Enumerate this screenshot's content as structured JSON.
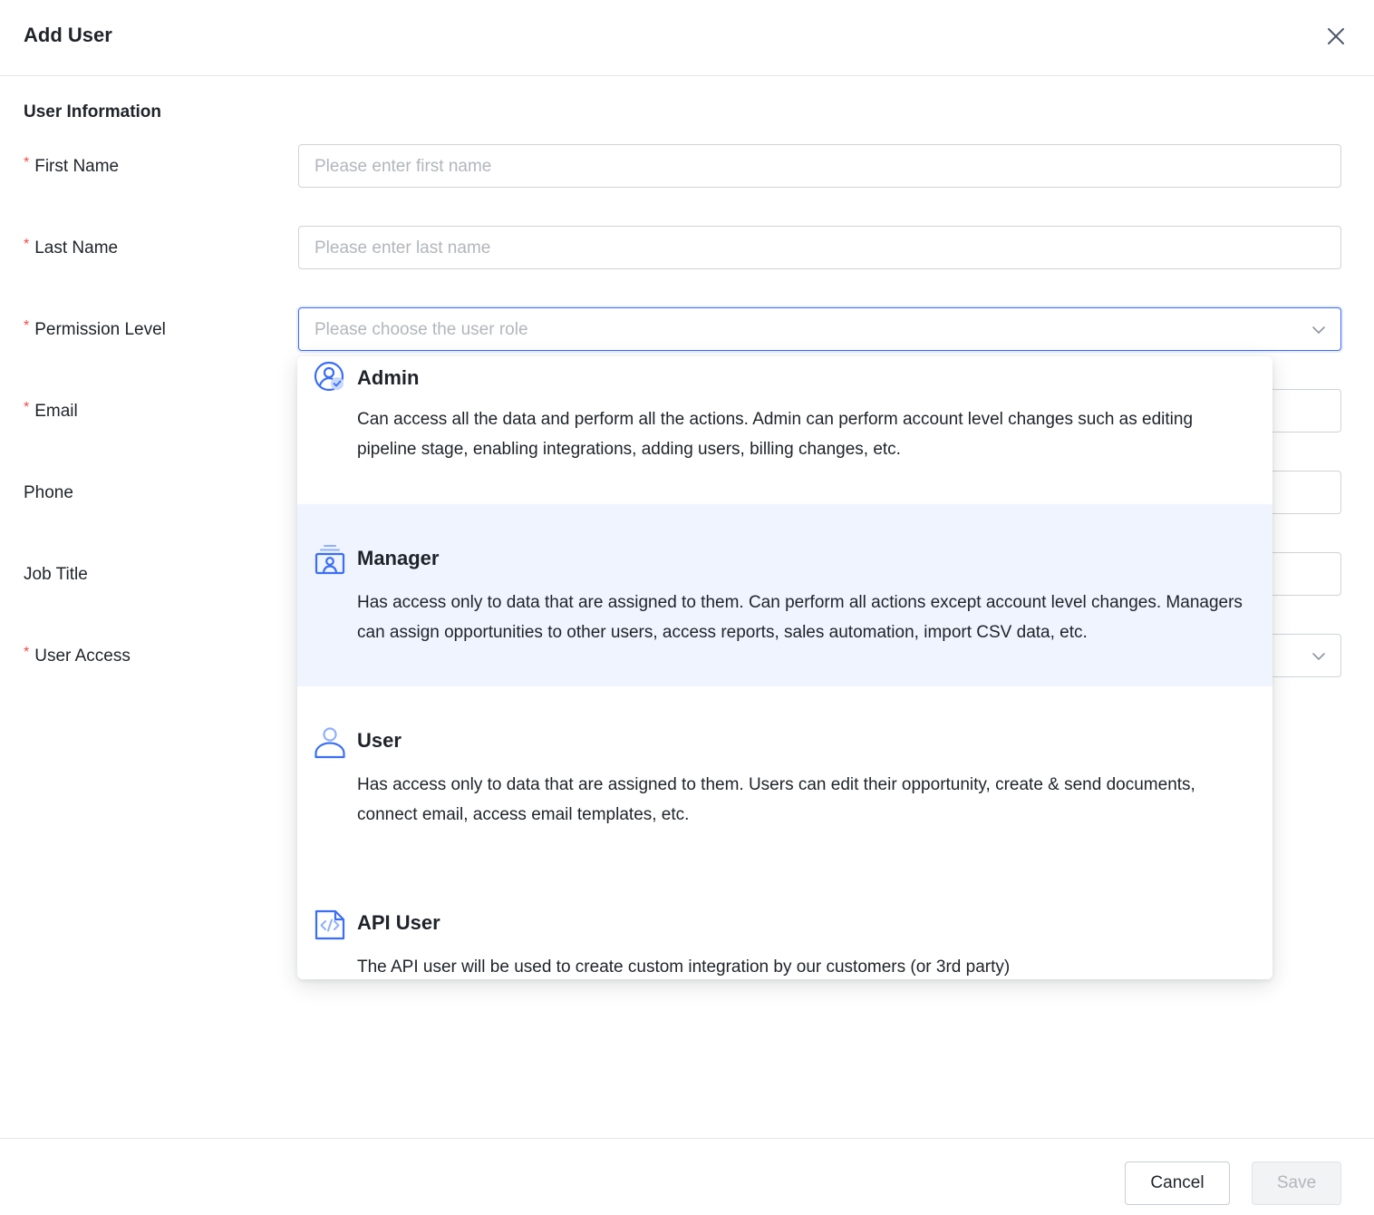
{
  "modal": {
    "title": "Add User"
  },
  "form": {
    "section_title": "User Information",
    "required_mark": "*",
    "first_name": {
      "label": "First Name",
      "placeholder": "Please enter first name"
    },
    "last_name": {
      "label": "Last Name",
      "placeholder": "Please enter last name"
    },
    "permission_level": {
      "label": "Permission Level",
      "placeholder": "Please choose the user role"
    },
    "email": {
      "label": "Email"
    },
    "phone": {
      "label": "Phone"
    },
    "job_title": {
      "label": "Job Title"
    },
    "user_access": {
      "label": "User Access"
    }
  },
  "role_dropdown": {
    "options": [
      {
        "title": "Admin",
        "icon": "admin-icon",
        "description": "Can access all the data and perform all the actions. Admin can perform account level changes such as editing pipeline stage, enabling integrations, adding users, billing changes, etc."
      },
      {
        "title": "Manager",
        "icon": "manager-icon",
        "description": "Has access only to data that are assigned to them. Can perform all actions except account level changes. Managers can assign opportunities to other users, access reports, sales automation, import CSV data, etc."
      },
      {
        "title": "User",
        "icon": "user-icon",
        "description": "Has access only to data that are assigned to them. Users can edit their opportunity, create & send documents, connect email, access email templates, etc."
      },
      {
        "title": "API User",
        "icon": "api-code-icon",
        "description": "The API user will be used to create custom integration by our customers (or 3rd party)"
      }
    ]
  },
  "footer": {
    "cancel_label": "Cancel",
    "save_label": "Save"
  },
  "colors": {
    "accent": "#3b6ef6",
    "required": "#f54a45",
    "hover_bg": "#eff4ff",
    "placeholder": "#b2b6bb"
  }
}
